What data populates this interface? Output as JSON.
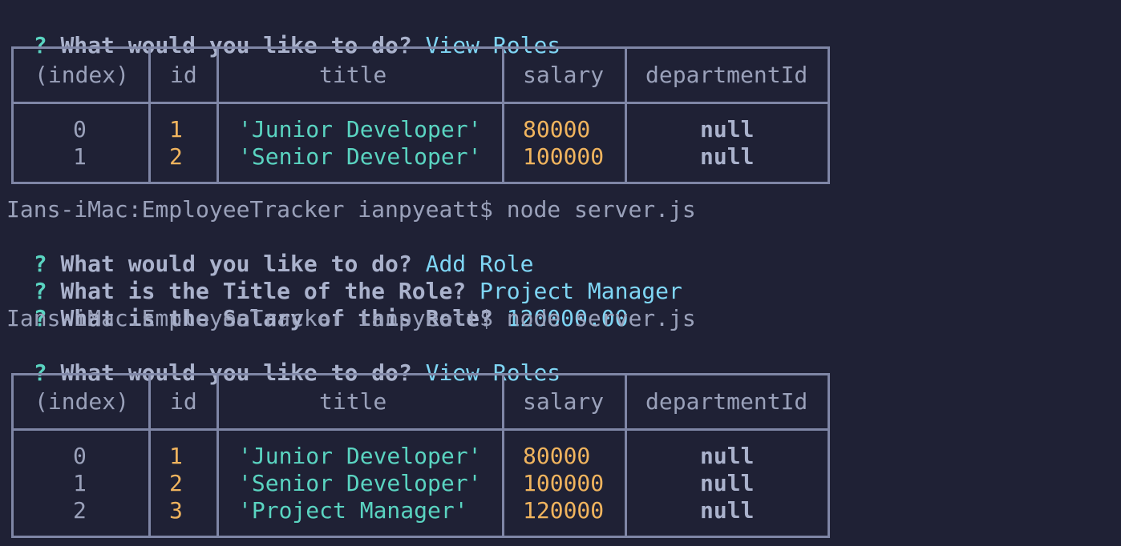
{
  "terminal": {
    "line0": {
      "prompt": "? ",
      "question": "What would you like to do? ",
      "answer": "View Roles"
    },
    "shell1": "Ians-iMac:EmployeeTracker ianpyeatt$ node server.js",
    "line2": {
      "prompt": "? ",
      "question": "What would you like to do? ",
      "answer": "Add Role"
    },
    "line3": {
      "prompt": "? ",
      "question": "What is the Title of the Role? ",
      "answer": "Project Manager"
    },
    "line4": {
      "prompt": "? ",
      "question": "What is the Salary of this Role? ",
      "answer": "120000.00"
    },
    "shell2": "Ians-iMac:EmployeeTracker ianpyeatt$ node server.js",
    "line5": {
      "prompt": "? ",
      "question": "What would you like to do? ",
      "answer": "View Roles"
    }
  },
  "table_headers": [
    "(index)",
    "id",
    "title",
    "salary",
    "departmentId"
  ],
  "table1": {
    "rows": [
      {
        "index": "0",
        "id": "1",
        "title": "'Junior Developer'",
        "salary": "80000",
        "departmentId": "null"
      },
      {
        "index": "1",
        "id": "2",
        "title": "'Senior Developer'",
        "salary": "100000",
        "departmentId": "null"
      }
    ]
  },
  "table2": {
    "rows": [
      {
        "index": "0",
        "id": "1",
        "title": "'Junior Developer'",
        "salary": "80000",
        "departmentId": "null"
      },
      {
        "index": "1",
        "id": "2",
        "title": "'Senior Developer'",
        "salary": "100000",
        "departmentId": "null"
      },
      {
        "index": "2",
        "id": "3",
        "title": "'Project Manager'",
        "salary": "120000",
        "departmentId": "null"
      }
    ]
  },
  "colors": {
    "background": "#1f2135",
    "prompt": "#5ad4c1",
    "answer": "#7fd6f5",
    "number": "#f0b45e",
    "string": "#5ad4c1",
    "border": "#7f86a6"
  }
}
